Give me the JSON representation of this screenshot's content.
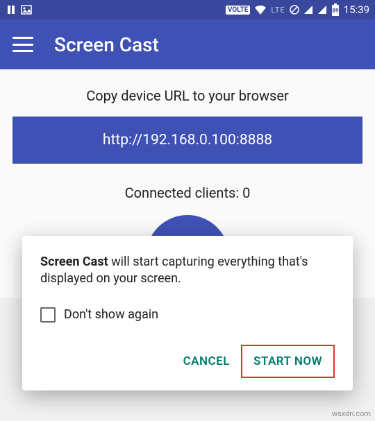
{
  "status": {
    "time": "15:39",
    "battery": "89",
    "volte": "VOLTE",
    "lte": "LTE"
  },
  "app": {
    "title": "Screen Cast"
  },
  "main": {
    "instruction": "Copy device URL to your browser",
    "url": "http://192.168.0.100:8888",
    "clients_label": "Connected clients: 0"
  },
  "dialog": {
    "bold": "Screen Cast",
    "body": " will start capturing everything that's displayed on your screen.",
    "dont_show": "Don't show again",
    "cancel": "CANCEL",
    "start": "START NOW"
  },
  "watermark": "wsxdn.com"
}
